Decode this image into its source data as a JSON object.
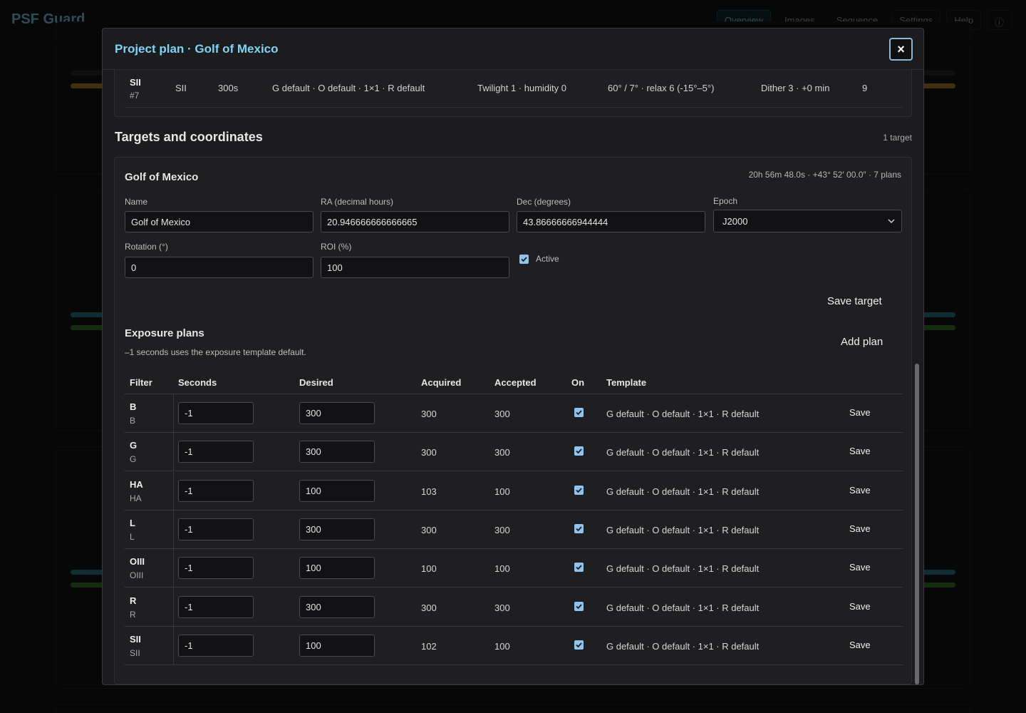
{
  "app": {
    "brand": "PSF Guard",
    "nav": [
      "Overview",
      "Images",
      "Sequence",
      "Settings",
      "Help"
    ]
  },
  "modal": {
    "title": "Project plan · Golf of Mexico",
    "close_label": "×",
    "previous_row": {
      "filter": "SII",
      "index": "#7",
      "filter_col": "SII",
      "exposure": "300s",
      "template": "G default · O default · 1×1 · R default",
      "twilight": "Twilight 1 · humidity 0",
      "altitude": "60° / 7° · relax 6 (-15°–5°)",
      "dither": "Dither 3 · +0 min",
      "count": "9"
    },
    "targets_section": {
      "title": "Targets and coordinates",
      "count": "1 target"
    },
    "target": {
      "name": "Golf of Mexico",
      "meta": "20h 56m 48.0s · +43° 52′ 00.0″ · 7 plans",
      "labels": {
        "name": "Name",
        "ra": "RA (decimal hours)",
        "dec": "Dec (degrees)",
        "epoch": "Epoch",
        "rotation": "Rotation (°)",
        "roi": "ROI (%)",
        "active": "Active"
      },
      "values": {
        "name": "Golf of Mexico",
        "ra": "20.946666666666665",
        "dec": "43.86666666944444",
        "epoch": "J2000",
        "rotation": "0",
        "roi": "100"
      },
      "save_label": "Save target"
    },
    "plans": {
      "title": "Exposure plans",
      "hint": "–1 seconds uses the exposure template default.",
      "add_label": "Add plan",
      "headers": {
        "filter": "Filter",
        "seconds": "Seconds",
        "desired": "Desired",
        "acquired": "Acquired",
        "accepted": "Accepted",
        "on": "On",
        "template": "Template"
      },
      "rows": [
        {
          "filter": "B",
          "sub": "B",
          "seconds": "-1",
          "desired": "300",
          "acquired": "300",
          "accepted": "300",
          "template": "G default · O default · 1×1 · R default",
          "save": "Save"
        },
        {
          "filter": "G",
          "sub": "G",
          "seconds": "-1",
          "desired": "300",
          "acquired": "300",
          "accepted": "300",
          "template": "G default · O default · 1×1 · R default",
          "save": "Save"
        },
        {
          "filter": "HA",
          "sub": "HA",
          "seconds": "-1",
          "desired": "100",
          "acquired": "103",
          "accepted": "100",
          "template": "G default · O default · 1×1 · R default",
          "save": "Save"
        },
        {
          "filter": "L",
          "sub": "L",
          "seconds": "-1",
          "desired": "300",
          "acquired": "300",
          "accepted": "300",
          "template": "G default · O default · 1×1 · R default",
          "save": "Save"
        },
        {
          "filter": "OIII",
          "sub": "OIII",
          "seconds": "-1",
          "desired": "100",
          "acquired": "100",
          "accepted": "100",
          "template": "G default · O default · 1×1 · R default",
          "save": "Save"
        },
        {
          "filter": "R",
          "sub": "R",
          "seconds": "-1",
          "desired": "300",
          "acquired": "300",
          "accepted": "300",
          "template": "G default · O default · 1×1 · R default",
          "save": "Save"
        },
        {
          "filter": "SII",
          "sub": "SII",
          "seconds": "-1",
          "desired": "100",
          "acquired": "102",
          "accepted": "100",
          "template": "G default · O default · 1×1 · R default",
          "save": "Save"
        }
      ]
    }
  },
  "colors": {
    "accent": "#7fd3f5",
    "checkbox": "#8fc3ec",
    "progress_teal": "#2a7f8f",
    "progress_green": "#3c7a2e",
    "progress_orange": "#b8862a"
  }
}
